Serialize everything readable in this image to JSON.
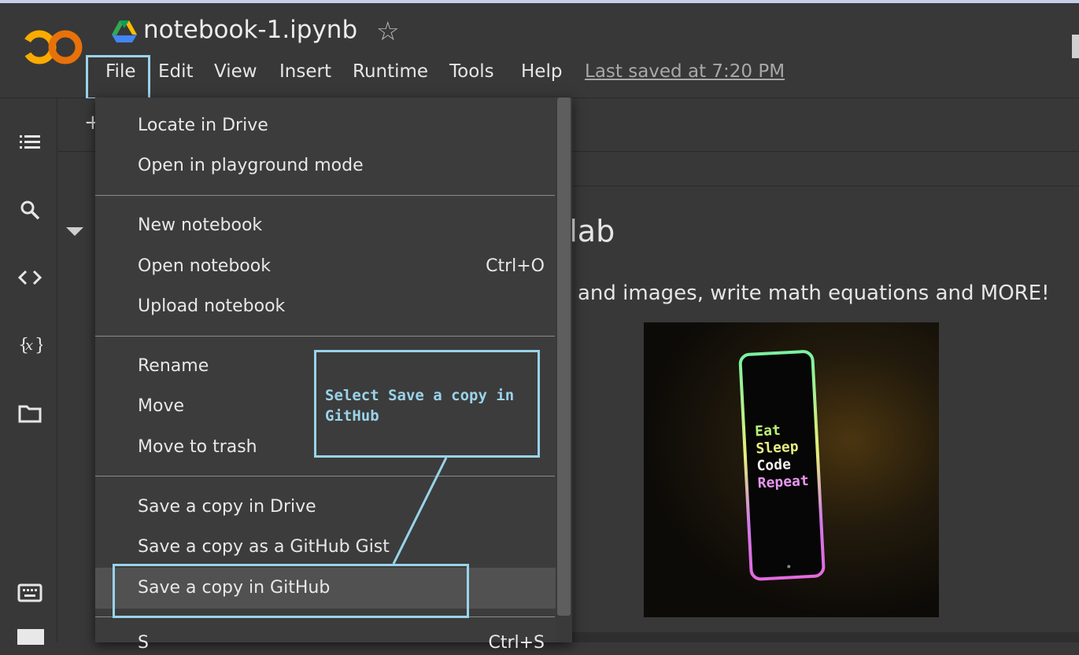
{
  "app": {
    "logo_text": "CO",
    "title": "notebook-1.ipynb",
    "last_saved": "Last saved at 7:20 PM"
  },
  "menubar": {
    "items": [
      "File",
      "Edit",
      "View",
      "Insert",
      "Runtime",
      "Tools",
      "Help"
    ]
  },
  "file_menu": {
    "locate": "Locate in Drive",
    "playground": "Open in playground mode",
    "new_notebook": "New notebook",
    "open_notebook": "Open notebook",
    "open_shortcut": "Ctrl+O",
    "upload": "Upload notebook",
    "rename": "Rename",
    "move": "Move",
    "trash": "Move to trash",
    "save_drive": "Save a copy in Drive",
    "save_gist": "Save a copy as a GitHub Gist",
    "save_github": "Save a copy in GitHub",
    "partial_item": "S",
    "partial_shortcut": "Ctrl+S"
  },
  "callout": {
    "text": "Select Save a copy in GitHub"
  },
  "cell": {
    "heading": "olab",
    "text": "and images, write math equations and MORE!",
    "photo_text": [
      "Eat",
      "Sleep",
      "Code",
      "Repeat"
    ]
  },
  "toolbar": {
    "add_label": "+"
  },
  "colors": {
    "annotation": "#9ad3ea",
    "background": "#383838",
    "menu": "#3c3c3c"
  }
}
